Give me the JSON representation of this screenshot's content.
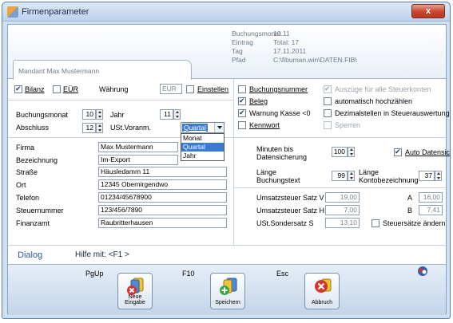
{
  "window": {
    "title": "Firmenparameter",
    "close": "x"
  },
  "header": {
    "info": [
      {
        "label": "Buchungsmonat",
        "value": "10.11"
      },
      {
        "label": "Eintrag",
        "value": "Total: 17"
      },
      {
        "label": "Tag",
        "value": "17.11.2011"
      },
      {
        "label": "Pfad",
        "value": "C:\\fibuman.win\\DATEN.FIB\\"
      }
    ],
    "mandant_tab": "Mandant  Max Mustermann"
  },
  "left": {
    "bilanz": "Bilanz",
    "eur": "EÜR",
    "waehrung_label": "Währung",
    "waehrung_value": "EUR",
    "einstellen": "Einstellen",
    "buchungsmonat_label": "Buchungsmonat",
    "buchungsmonat_value": "10",
    "jahr_label": "Jahr",
    "jahr_value": "11",
    "abschluss_label": "Abschluss",
    "abschluss_value": "12",
    "ust_label": "USt.Voranm.",
    "ust_value": "Quartal",
    "ust_options": [
      "Monat",
      "Quartal",
      "Jahr"
    ],
    "fields": [
      {
        "label": "Firma",
        "value": "Max Mustermann"
      },
      {
        "label": "Bezeichnung",
        "value": "Im-Export"
      },
      {
        "label": "Straße",
        "value": "Häusledamm 11"
      },
      {
        "label": "Ort",
        "value": "12345 Obernirgendwo"
      },
      {
        "label": "Telefon",
        "value": "01234/45678900"
      },
      {
        "label": "Steuernummer",
        "value": "123/456/7890"
      },
      {
        "label": "Finanzamt",
        "value": "Raubritterhausen"
      }
    ]
  },
  "right": {
    "buchungsnummer": "Buchungsnummer",
    "auszuege": "Auszüge für alle Steuerkonten",
    "beleg": "Beleg",
    "automatisch": "automatisch hochzählen",
    "warnung": "Warnung Kasse <0",
    "dezimal": "Dezimalstellen in Steuerauswertung",
    "kennwort": "Kennwort",
    "sperren": "Sperren",
    "minuten_label_1": "Minuten bis",
    "minuten_label_2": "Datensicherung",
    "minuten_value": "100",
    "auto_datensicherung": "Auto Datensicherung",
    "laenge_b_1": "Länge",
    "laenge_b_2": "Buchungstext",
    "laenge_b_value": "99",
    "laenge_k_1": "Länge",
    "laenge_k_2": "Kontobezeichnung",
    "laenge_k_value": "37",
    "ust_v_label": "Umsatzsteuer Satz V",
    "ust_v_value": "19,00",
    "ust_a_label": "A",
    "ust_a_value": "16,00",
    "ust_h_label": "Umsatzsteuer Satz H",
    "ust_h_value": "7,00",
    "ust_b_label": "B",
    "ust_b_value": "7,41",
    "ust_s_label": "USt.Sondersatz S",
    "ust_s_value": "13,10",
    "steuersaetze": "Steuersätze ändern"
  },
  "dialog": {
    "label": "Dialog",
    "help": "Hilfe mit: <F1 >"
  },
  "footer": {
    "keys": [
      "PgUp",
      "F10",
      "Esc"
    ],
    "buttons": [
      "Neue Eingabe",
      "Speichern",
      "Abbruch"
    ]
  }
}
